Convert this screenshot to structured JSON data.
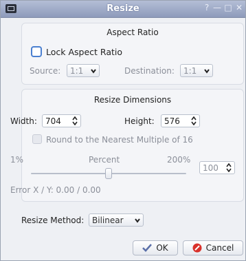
{
  "window": {
    "title": "Resize"
  },
  "aspect": {
    "title": "Aspect Ratio",
    "lock_label": "Lock Aspect Ratio",
    "source_label": "Source:",
    "source_value": "1:1",
    "destination_label": "Destination:",
    "destination_value": "1:1"
  },
  "dimensions": {
    "title": "Resize Dimensions",
    "width_label": "Width:",
    "width_value": "704",
    "height_label": "Height:",
    "height_value": "576",
    "round_label": "Round to the Nearest Multiple of 16",
    "min_label": "1%",
    "mid_label": "Percent",
    "max_label": "200%",
    "percent_value": "100",
    "slider_fraction": 0.5,
    "error_text": "Error X / Y: 0.00 / 0.00"
  },
  "method": {
    "label": "Resize Method:",
    "value": "Bilinear"
  },
  "buttons": {
    "ok": "OK",
    "cancel": "Cancel"
  },
  "colors": {
    "title_bar": "#98a6c4",
    "focus_ring": "#4a7fd0",
    "cancel_icon": "#d9312b",
    "ok_icon": "#5a6fa8"
  }
}
